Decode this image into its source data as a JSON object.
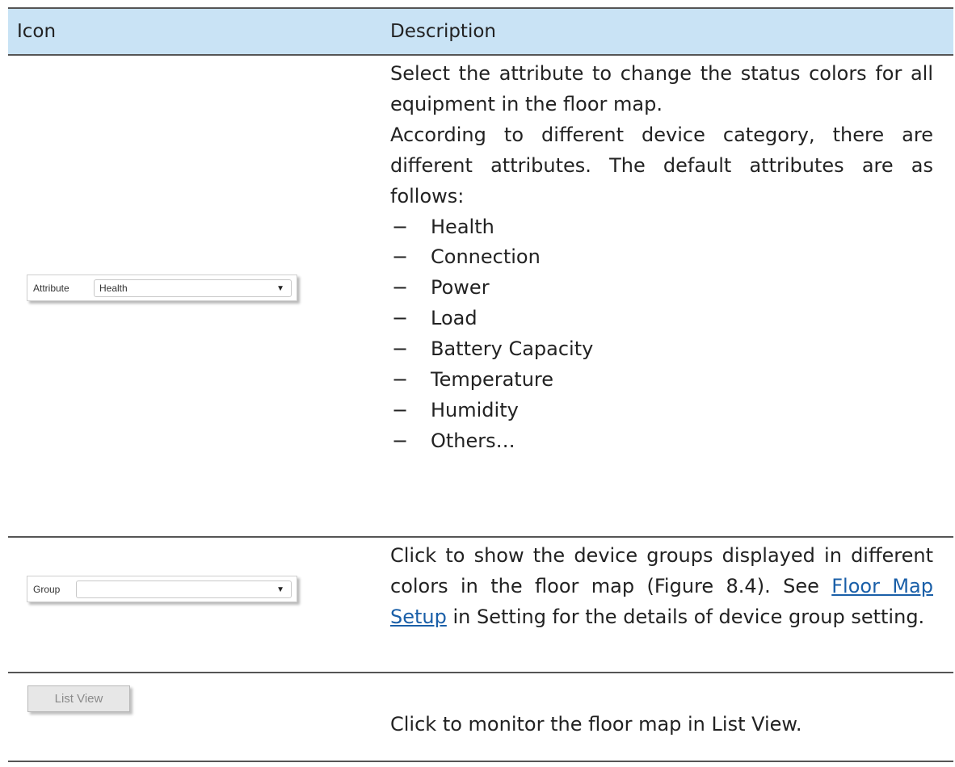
{
  "table": {
    "headers": {
      "icon": "Icon",
      "description": "Description"
    },
    "rows": [
      {
        "widget": {
          "label": "Attribute",
          "value": "Health",
          "arrow": "▼"
        },
        "paragraphs": [
          "Select the attribute to change the status colors for all equipment in the floor map.",
          "According to different device category, there are different attributes. The default attributes are as follows:"
        ],
        "bullet": "−",
        "items": [
          "Health",
          "Connection",
          "Power",
          "Load",
          "Battery Capacity",
          "Temperature",
          "Humidity",
          "Others…"
        ]
      },
      {
        "widget": {
          "label": "Group",
          "value": "",
          "arrow": "▼"
        },
        "text_before": "Click to show the device groups displayed in different colors in the floor map (Figure 8.4). See ",
        "link": "Floor Map Setup",
        "text_after": " in Setting for the details of device group setting."
      },
      {
        "button": "List View",
        "text": "Click to monitor the floor map in List View."
      }
    ]
  }
}
